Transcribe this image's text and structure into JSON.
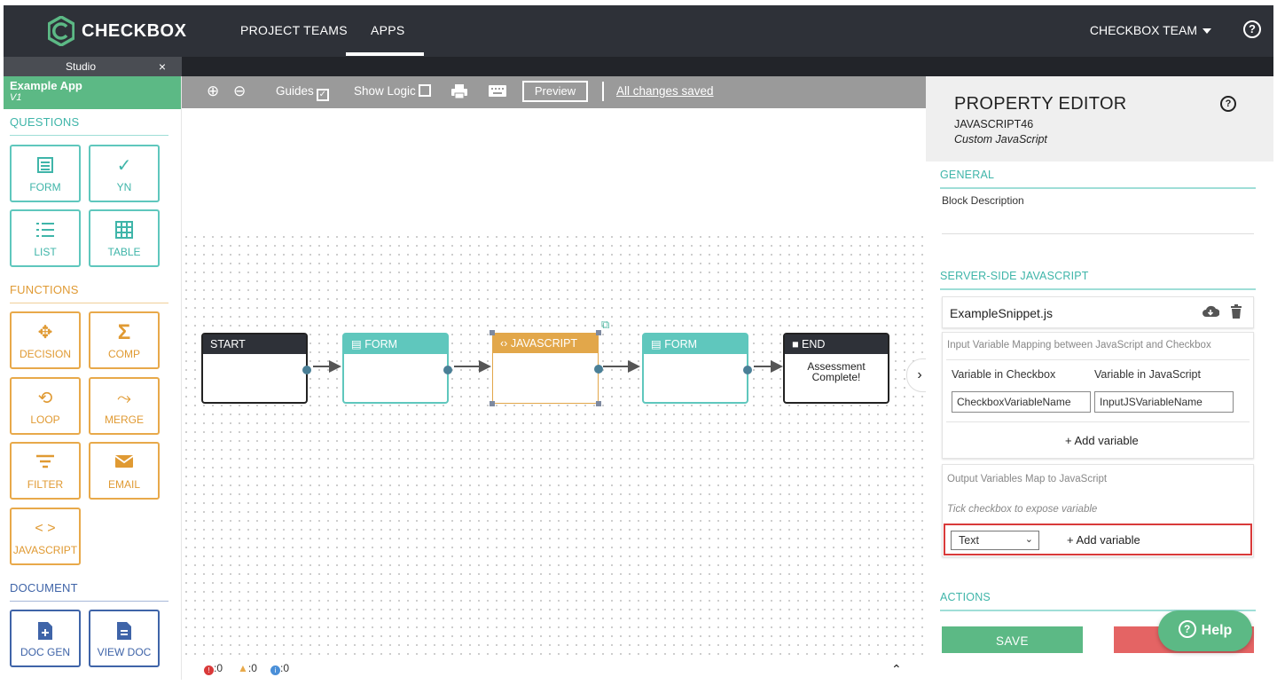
{
  "topnav": {
    "brand": "CHECKBOX",
    "items": [
      "PROJECT TEAMS",
      "APPS"
    ],
    "team": "CHECKBOX TEAM",
    "help": "?"
  },
  "studio_tab": {
    "label": "Studio",
    "close": "×"
  },
  "app": {
    "name": "Example App",
    "version": "V1"
  },
  "sidebar": {
    "questions_title": "QUESTIONS",
    "questions": [
      "FORM",
      "YN",
      "LIST",
      "TABLE"
    ],
    "functions_title": "FUNCTIONS",
    "functions": [
      "DECISION",
      "COMP",
      "LOOP",
      "MERGE",
      "FILTER",
      "EMAIL",
      "JAVASCRIPT"
    ],
    "document_title": "DOCUMENT",
    "document": [
      "DOC GEN",
      "VIEW DOC"
    ]
  },
  "toolbar": {
    "guides": "Guides",
    "show_logic": "Show Logic",
    "preview": "Preview",
    "saved": "All changes saved"
  },
  "nodes": [
    {
      "title": "START",
      "body": ""
    },
    {
      "title": "FORM",
      "body": ""
    },
    {
      "title": "JAVASCRIPT",
      "body": ""
    },
    {
      "title": "FORM",
      "body": ""
    },
    {
      "title": "END",
      "body": "Assessment Complete!"
    }
  ],
  "statusbar": {
    "errors": ":0",
    "warnings": ":0",
    "info": ":0"
  },
  "property_editor": {
    "title": "PROPERTY EDITOR",
    "id": "JAVASCRIPT46",
    "type": "Custom JavaScript",
    "general": "GENERAL",
    "block_description": "Block Description",
    "server_js": "SERVER-SIDE JAVASCRIPT",
    "snippet": "ExampleSnippet.js",
    "input_mapping": "Input Variable Mapping between JavaScript and Checkbox",
    "col_checkbox": "Variable in Checkbox",
    "col_js": "Variable in JavaScript",
    "checkbox_var": "CheckboxVariableName",
    "js_var": "InputJSVariableName",
    "add_variable": "+ Add variable",
    "output_mapping": "Output Variables Map to JavaScript",
    "output_hint": "Tick checkbox to expose variable",
    "type_select": "Text",
    "actions": "ACTIONS",
    "save": "SAVE"
  },
  "help_fab": "Help",
  "colors": {
    "nav_bg": "#2e3138",
    "green": "#5cb985",
    "teal": "#5fc7bd",
    "orange": "#e2a74a",
    "navy": "#3f64a8",
    "danger": "#e46464"
  }
}
